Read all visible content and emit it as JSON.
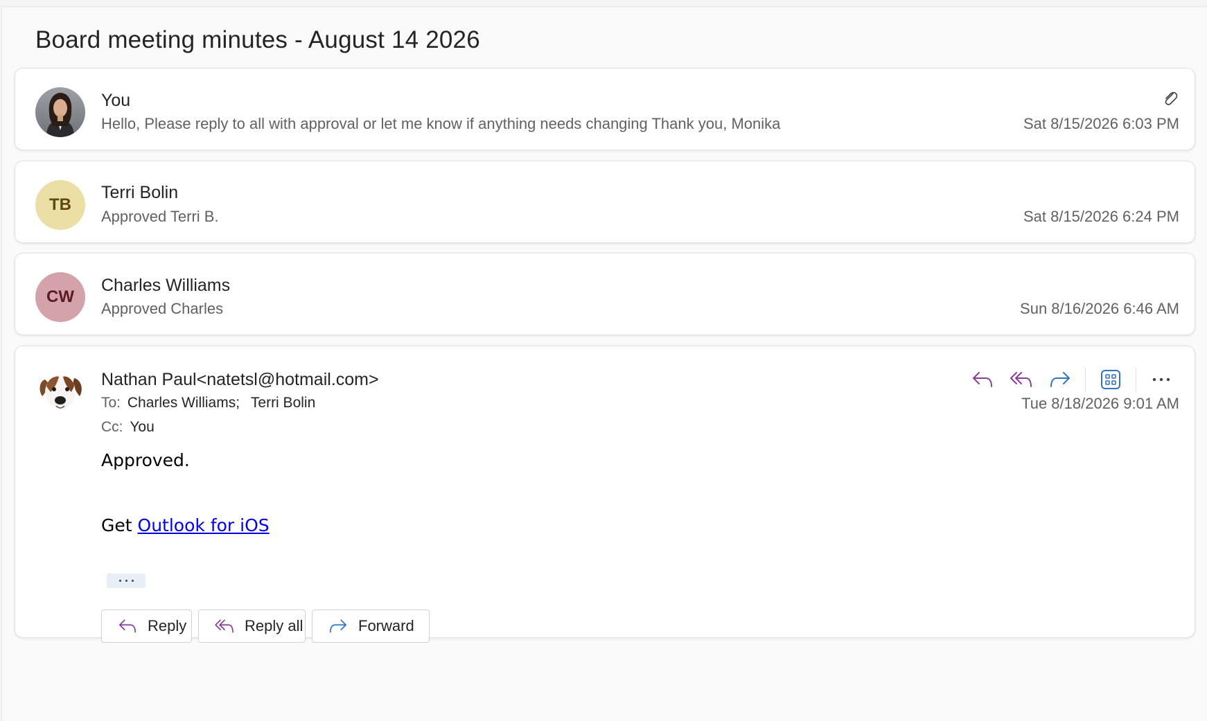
{
  "subject": "Board meeting minutes - August 14 2026",
  "colors": {
    "reply_purple": "#8a3c9c",
    "forward_blue": "#2f73c4",
    "link_blue": "#0000ee",
    "tb_avatar_bg": "#ebdfa5",
    "tb_avatar_fg": "#5c4a10",
    "cw_avatar_bg": "#d4a3aa",
    "cw_avatar_fg": "#5b1a24"
  },
  "messages": [
    {
      "sender": "You",
      "preview": "Hello, Please reply to all with approval or let me know if anything needs changing Thank you, Monika",
      "date": "Sat 8/15/2026 6:03 PM",
      "avatar": "photo-woman",
      "has_attachment_icon": "paperclip-icon"
    },
    {
      "sender": "Terri Bolin",
      "preview": "Approved Terri B.",
      "date": "Sat 8/15/2026 6:24 PM",
      "initials": "TB"
    },
    {
      "sender": "Charles Williams",
      "preview": "Approved Charles",
      "date": "Sun 8/16/2026 6:46 AM",
      "initials": "CW"
    }
  ],
  "expanded": {
    "sender": "Nathan Paul<natetsl@hotmail.com>",
    "avatar": "photo-dog",
    "to_label": "To:",
    "to_recipients": [
      "Charles Williams;",
      "Terri Bolin"
    ],
    "cc_label": "Cc:",
    "cc_recipients": "You",
    "date": "Tue 8/18/2026 9:01 AM",
    "body_line1": "Approved.",
    "body_get": "Get",
    "body_link": "Outlook for iOS",
    "toolbar_icons": [
      "reply-icon",
      "reply-all-icon",
      "forward-icon",
      "apps-icon",
      "more-icon"
    ],
    "buttons": {
      "reply": "Reply",
      "reply_all": "Reply all",
      "forward": "Forward"
    }
  }
}
